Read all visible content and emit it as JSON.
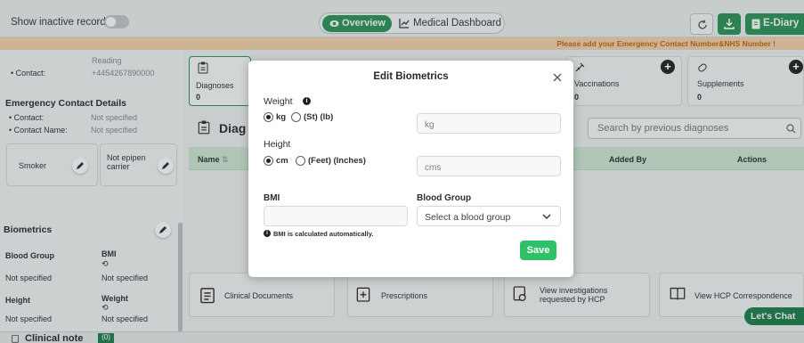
{
  "topbar": {
    "show_inactive_label": "Show inactive records",
    "tab_overview": "Overview",
    "tab_medical_dashboard": "Medical Dashboard",
    "ediary_label": "E-Diary"
  },
  "banner": {
    "text": "Please add your Emergency Contact Number&NHS Number !"
  },
  "left": {
    "contact_city": "Reading",
    "contact_label": "Contact:",
    "contact_value": "+4454267890000",
    "emergency_title": "Emergency Contact Details",
    "em_contact_label": "Contact:",
    "em_contact_value": "Not specified",
    "em_name_label": "Contact Name:",
    "em_name_value": "Not specified",
    "smoker_label": "Smoker",
    "epipen_label_1": "Not epipen",
    "epipen_label_2": "carrier",
    "biometrics_title": "Biometrics",
    "blood_group_label": "Blood Group",
    "blood_group_value": "Not specified",
    "bmi_label": "BMI",
    "bmi_value": "Not specified",
    "height_label": "Height",
    "height_value": "Not specified",
    "weight_label": "Weight",
    "weight_value": "Not specified"
  },
  "main": {
    "diagnoses_label": "Diagnoses",
    "diagnoses_count": "0",
    "vaccinations_label": "Vaccinations",
    "vaccinations_count": "0",
    "supplements_label": "Supplements",
    "supplements_count": "0",
    "diag_heading": "Diag",
    "search_placeholder": "Search by previous diagnoses",
    "col_name": "Name",
    "col_added_by": "Added By",
    "col_actions": "Actions",
    "card_clinical_docs": "Clinical Documents",
    "card_prescriptions": "Prescriptions",
    "card_view_inv_1": "View investigations",
    "card_view_inv_2": "requested by HCP",
    "card_view_hcp": "View HCP Correspondence",
    "lets_chat": "Let's Chat"
  },
  "bottom": {
    "clinical_note": "Clinical note",
    "badge": "(0)"
  },
  "modal": {
    "title": "Edit Biometrics",
    "weight_label": "Weight",
    "weight_opt_kg": "kg",
    "weight_opt_st": "(St) (lb)",
    "weight_placeholder": "kg",
    "height_label": "Height",
    "height_opt_cm": "cm",
    "height_opt_ft": "(Feet) (Inches)",
    "height_placeholder": "cms",
    "bmi_label": "BMI",
    "bmi_note": "BMI is calculated automatically.",
    "blood_group_label": "Blood Group",
    "blood_group_placeholder": "Select a blood group",
    "save_label": "Save"
  },
  "colors": {
    "brand_green": "#2e8f58",
    "save_green": "#30c168",
    "banner_bg": "#e5c8a2",
    "banner_text": "#b3641c"
  }
}
